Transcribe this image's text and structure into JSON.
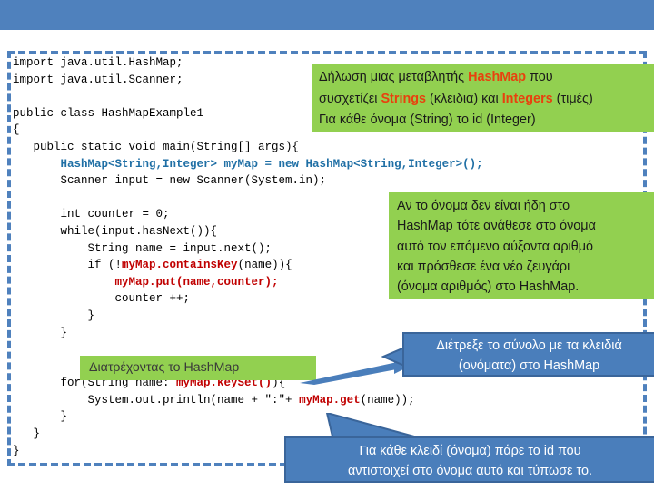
{
  "slide": {
    "title_bar_color": "#4F81BD",
    "frame_color": "#4F81BD",
    "note_color": "#92D050",
    "callout_color": "#4A7EBB",
    "keyword_color": "#1F6FA5",
    "highlight_color": "#C00000",
    "accent_red": "#E8410E"
  },
  "code": {
    "lines": [
      [
        {
          "t": "import java.util.HashMap;",
          "c": "plain"
        }
      ],
      [
        {
          "t": "import java.util.Scanner;",
          "c": "plain"
        }
      ],
      [
        {
          "t": "",
          "c": "plain"
        }
      ],
      [
        {
          "t": "public class HashMapExample1",
          "c": "plain"
        }
      ],
      [
        {
          "t": "{",
          "c": "plain"
        }
      ],
      [
        {
          "t": "   public static void main(String[] args){",
          "c": "plain"
        }
      ],
      [
        {
          "t": "       ",
          "c": "plain"
        },
        {
          "t": "HashMap<String,Integer> myMap = new HashMap<String,Integer>();",
          "c": "blue"
        }
      ],
      [
        {
          "t": "       Scanner input = new Scanner(System.in);",
          "c": "plain"
        }
      ],
      [
        {
          "t": "",
          "c": "plain"
        }
      ],
      [
        {
          "t": "       int counter = 0;",
          "c": "plain"
        }
      ],
      [
        {
          "t": "       while(input.hasNext()){",
          "c": "plain"
        }
      ],
      [
        {
          "t": "           String name = input.next();",
          "c": "plain"
        }
      ],
      [
        {
          "t": "           if (!",
          "c": "plain"
        },
        {
          "t": "myMap.containsKey",
          "c": "red"
        },
        {
          "t": "(name)){",
          "c": "plain"
        }
      ],
      [
        {
          "t": "               ",
          "c": "plain"
        },
        {
          "t": "myMap.put(name,counter);",
          "c": "red"
        }
      ],
      [
        {
          "t": "               counter ++;",
          "c": "plain"
        }
      ],
      [
        {
          "t": "           }",
          "c": "plain"
        }
      ],
      [
        {
          "t": "       }",
          "c": "plain"
        }
      ],
      [
        {
          "t": "",
          "c": "plain"
        }
      ],
      [
        {
          "t": "",
          "c": "plain"
        }
      ],
      [
        {
          "t": "       for(String name: ",
          "c": "plain"
        },
        {
          "t": "myMap.keySet()",
          "c": "red"
        },
        {
          "t": "){",
          "c": "plain"
        }
      ],
      [
        {
          "t": "           System.out.println(name + \":\"+ ",
          "c": "plain"
        },
        {
          "t": "myMap.get",
          "c": "red"
        },
        {
          "t": "(name));",
          "c": "plain"
        }
      ],
      [
        {
          "t": "       }",
          "c": "plain"
        }
      ],
      [
        {
          "t": "   }",
          "c": "plain"
        }
      ],
      [
        {
          "t": "}",
          "c": "plain"
        }
      ]
    ]
  },
  "notes": {
    "declaration": {
      "line1_a": "Δήλωση μιας μεταβλητής ",
      "line1_hl": "HashMap",
      "line1_b": "  που",
      "line2_a": "συσχετίζει ",
      "line2_hl1": "Strings",
      "line2_b": " (κλειδια) και ",
      "line2_hl2": "Integers",
      "line2_c": " (τιμές)",
      "line3": "Για κάθε όνομα (String) το id (Integer)"
    },
    "ifnotexists": {
      "line1": "Αν το όνομα δεν είναι ήδη στο",
      "line2": "HashMap τότε ανάθεσε στο όνομα",
      "line3": "αυτό τον επόμενο αύξοντα αριθμό",
      "line4": "και πρόσθεσε ένα νέο ζευγάρι",
      "line5": "(όνομα αριθμός) στο HashMap."
    },
    "traverse_label": "Διατρέχοντας το HashMap"
  },
  "callouts": {
    "keyset": {
      "line1": "Διέτρεξε το σύνολο με τα κλειδιά",
      "line2": "(ονόματα) στο HashMap"
    },
    "getid": {
      "line1": "Για κάθε κλειδί (όνομα) πάρε το id που",
      "line2": "αντιστοιχεί στο όνομα αυτό και τύπωσε το."
    }
  }
}
